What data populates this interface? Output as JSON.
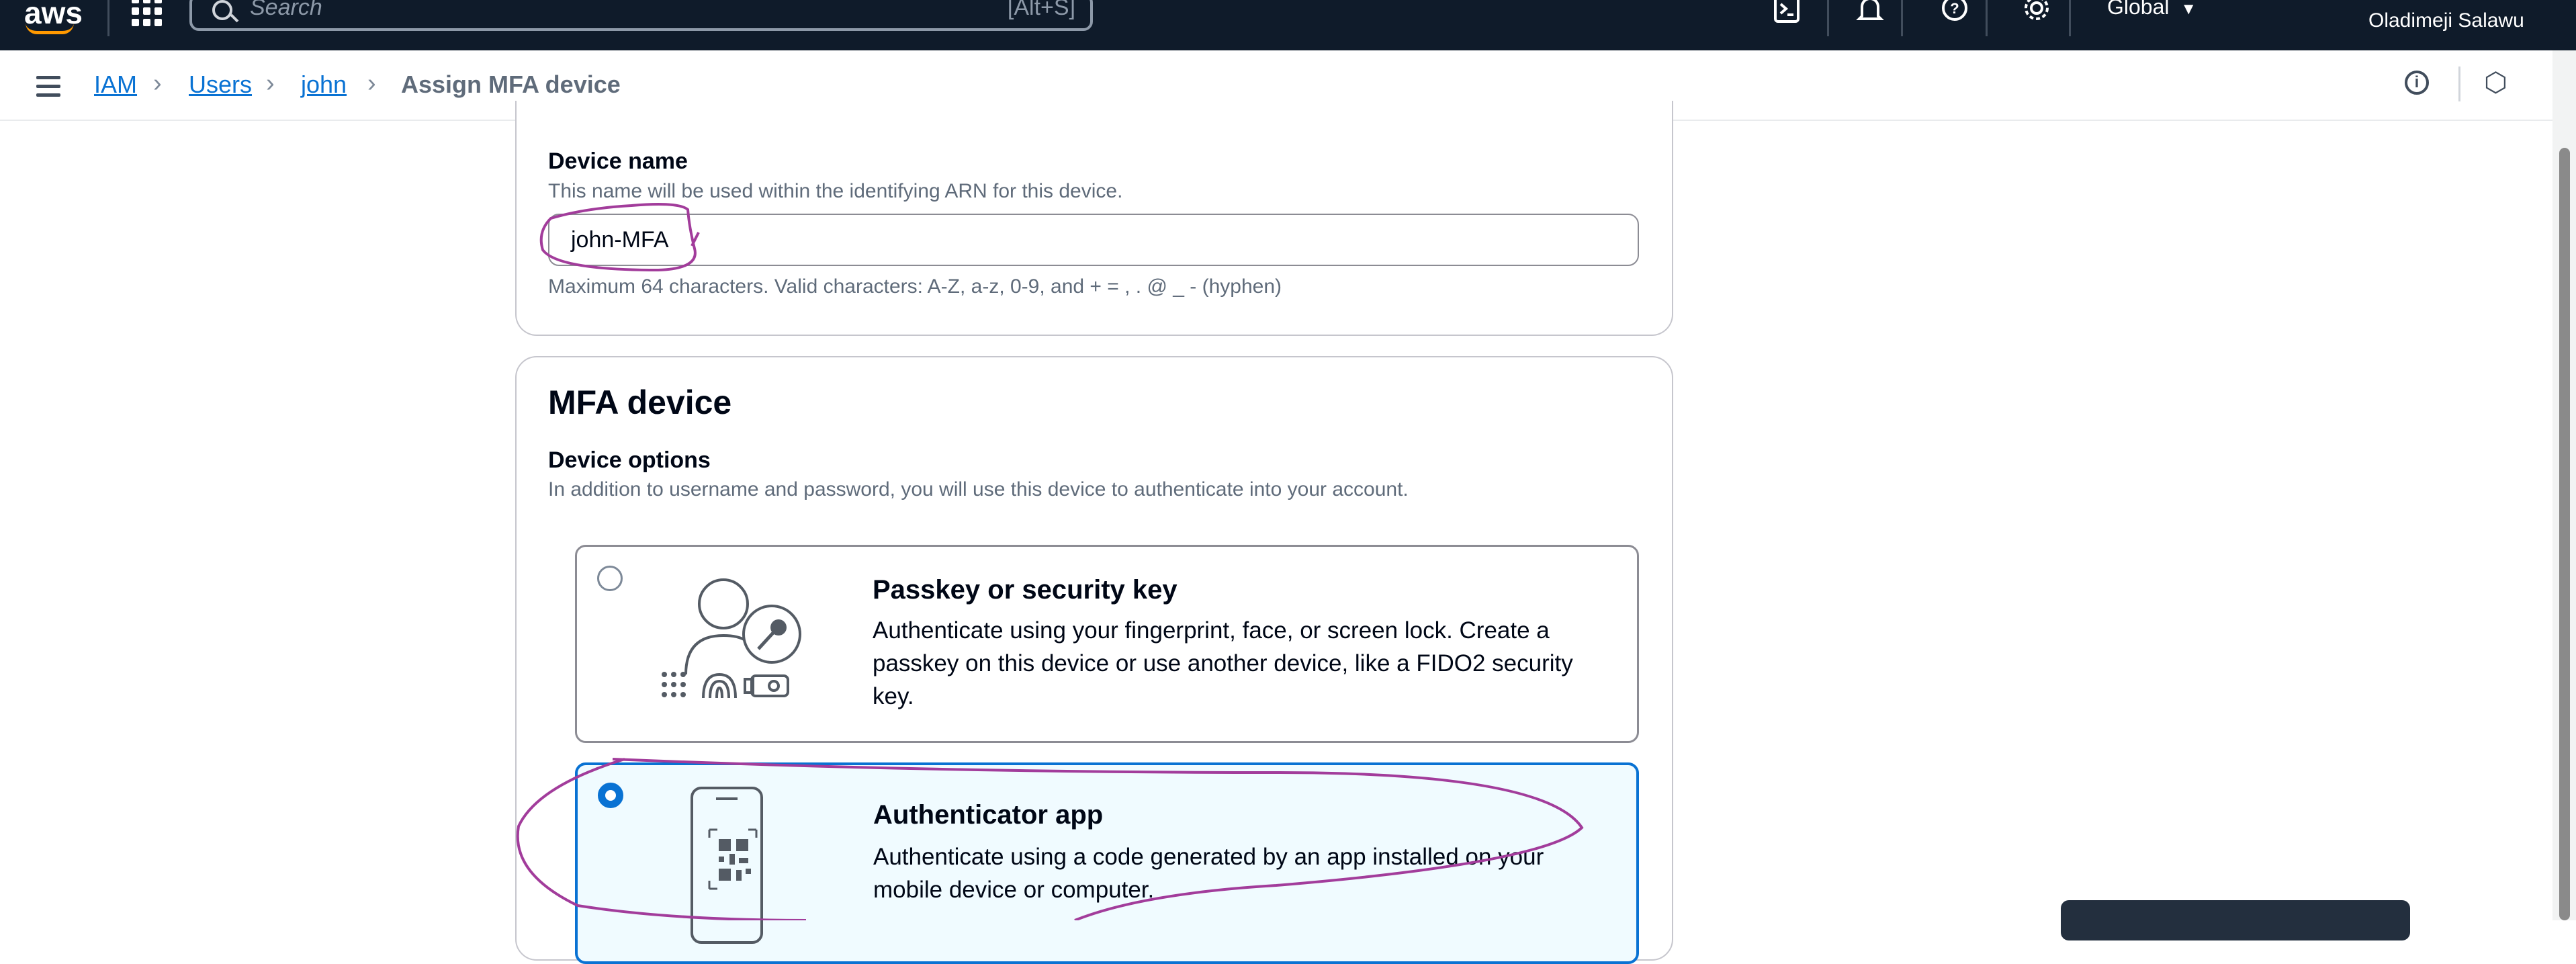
{
  "topbar": {
    "search_placeholder": "Search",
    "search_shortcut": "[Alt+S]",
    "region": "Global",
    "region_caret": "▼",
    "user": "Oladimeji Salawu"
  },
  "breadcrumb": {
    "items": [
      "IAM",
      "Users",
      "john"
    ],
    "current": "Assign MFA device",
    "separator": "›"
  },
  "device_name": {
    "label": "Device name",
    "description": "This name will be used within the identifying ARN for this device.",
    "value": "john-MFA",
    "constraint": "Maximum 64 characters. Valid characters: A-Z, a-z, 0-9, and + = , . @ _ - (hyphen)"
  },
  "mfa_device": {
    "heading": "MFA device",
    "options_label": "Device options",
    "options_description": "In addition to username and password, you will use this device to authenticate into your account.",
    "options": [
      {
        "title": "Passkey or security key",
        "description": "Authenticate using your fingerprint, face, or screen lock. Create a passkey on this device or use another device, like a FIDO2 security key.",
        "selected": false
      },
      {
        "title": "Authenticator app",
        "description": "Authenticate using a code generated by an app installed on your mobile device or computer.",
        "selected": true
      }
    ]
  },
  "colors": {
    "nav_bg": "#0f1b2a",
    "accent": "#0972d3",
    "annotation": "#a23c9b",
    "selected_tile_bg": "#f0fbff"
  }
}
